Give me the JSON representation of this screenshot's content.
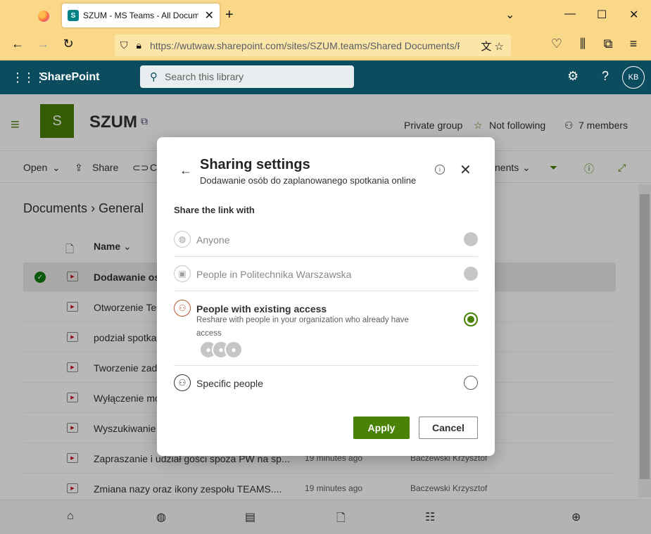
{
  "browser": {
    "tab_title": "SZUM - MS Teams - All Documents",
    "url": "https://wutwaw.sharepoint.com/sites/SZUM.teams/Shared Documents/F"
  },
  "sharepoint": {
    "brand": "SharePoint",
    "search_placeholder": "Search this library",
    "avatar_initials": "KB"
  },
  "site": {
    "logo_letter": "S",
    "name": "SZUM",
    "privacy": "Private group",
    "follow": "Not following",
    "members": "7 members"
  },
  "commands": {
    "open": "Open",
    "share": "Share",
    "copy_partial": "C",
    "view_partial": "nents"
  },
  "breadcrumb": {
    "root": "Documents",
    "current": "General"
  },
  "list": {
    "name_header": "Name",
    "rows": [
      {
        "name": "Dodawanie oso",
        "modified": "",
        "by": ""
      },
      {
        "name": "Otworzenie Tea",
        "modified": "",
        "by": ""
      },
      {
        "name": "podział spotka",
        "modified": "",
        "by": ""
      },
      {
        "name": "Tworzenie zada",
        "modified": "",
        "by": ""
      },
      {
        "name": "Wyłączenie mo",
        "modified": "",
        "by": ""
      },
      {
        "name": "Wyszukiwanie",
        "modified": "",
        "by": ""
      },
      {
        "name": "Zapraszanie i udział gości spoza PW na sp...",
        "modified": "19 minutes ago",
        "by": "Baczewski Krzysztof"
      },
      {
        "name": "Zmiana nazy oraz ikony zespołu TEAMS....",
        "modified": "19 minutes ago",
        "by": "Baczewski Krzysztof"
      }
    ]
  },
  "dialog": {
    "title": "Sharing settings",
    "subtitle": "Dodawanie osób do zaplanowanego spotkania online",
    "share_label": "Share the link with",
    "options": [
      {
        "label": "Anyone",
        "description": "",
        "state": "disabled"
      },
      {
        "label": "People in Politechnika Warszawska",
        "description": "",
        "state": "disabled"
      },
      {
        "label": "People with existing access",
        "description": "Reshare with people in your organization who already have access",
        "state": "selected"
      },
      {
        "label": "Specific people",
        "description": "",
        "state": "unselected"
      }
    ],
    "apply_label": "Apply",
    "cancel_label": "Cancel"
  },
  "colors": {
    "accent": "#498205",
    "suite_bar": "#0b4d5e",
    "browser_chrome": "#f9d88a"
  }
}
